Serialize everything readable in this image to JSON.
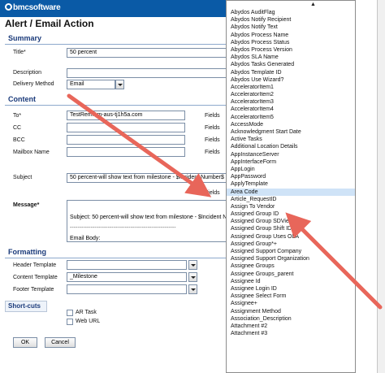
{
  "brand": {
    "logo_text": "bmcsoftware"
  },
  "page_title": "Alert / Email Action",
  "sections": {
    "summary": "Summary",
    "content": "Content",
    "formatting": "Formatting",
    "shortcuts": "Short-cuts"
  },
  "summary": {
    "title_label": "Title*",
    "title_value": "50 percent",
    "description_label": "Description",
    "delivery_label": "Delivery Method",
    "delivery_value": "Email"
  },
  "content": {
    "to_label": "To*",
    "to_value": "TestRem...m-aus-tj1h5a.com",
    "cc_label": "CC",
    "bcc_label": "BCC",
    "mailbox_label": "Mailbox Name",
    "subject_label": "Subject",
    "subject_value": "50 percent-will show text from milestone  - $Incident Number$",
    "message_label": "Message*",
    "message_lines": [
      "Subject:  50 percent-will show text from milestone  - $Incident Number$",
      "--------------------------------------------------------",
      "Email Body:"
    ],
    "fields_label": "Fields"
  },
  "formatting": {
    "header_label": "Header Template",
    "content_label": "Content Template",
    "content_value": "_Milestone",
    "footer_label": "Footer Template"
  },
  "shortcuts": {
    "ar_task": "AR Task",
    "web_url": "Web URL"
  },
  "buttons": {
    "ok": "OK",
    "cancel": "Cancel"
  },
  "field_list": {
    "scroll_up_glyph": "▲",
    "selected": "Area Code",
    "items": [
      "Abydos AuditFlag",
      "Abydos Notify Recipient",
      "Abydos Notify Text",
      "Abydos Process Name",
      "Abydos Process Status",
      "Abydos Process Version",
      "Abydos SLA Name",
      "Abydos Tasks Generated",
      "Abydos Template ID",
      "Abydos Use Wizard?",
      "AcceleratorItem1",
      "AcceleratorItem2",
      "AcceleratorItem3",
      "AcceleratorItem4",
      "AcceleratorItem5",
      "AccessMode",
      "Acknowledgment Start Date",
      "Active Tasks",
      "Additional Location Details",
      "AppInstanceServer",
      "AppInterfaceForm",
      "AppLogin",
      "AppPassword",
      "ApplyTemplate",
      "Area Code",
      "Article_RequestID",
      "Assign To Vendor",
      "Assigned Group ID",
      "Assigned Group SDView",
      "Assigned Group Shift ID",
      "Assigned Group Uses OLA",
      "Assigned Group*+",
      "Assigned Support Company",
      "Assigned Support Organization",
      "Assignee Groups",
      "Assignee Groups_parent",
      "Assignee Id",
      "Assignee Login ID",
      "Assignee Select Form",
      "Assignee+",
      "Assignment Method",
      "Association_Description",
      "Attachment #2",
      "Attachment #3"
    ]
  }
}
